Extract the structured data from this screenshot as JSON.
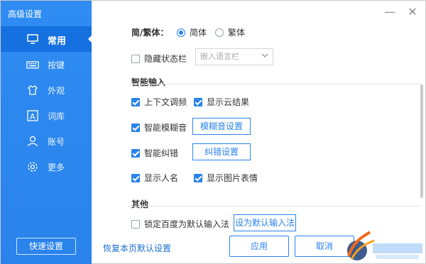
{
  "window": {
    "title": "高级设置",
    "controls": {
      "minimize": "—",
      "close": "✕"
    }
  },
  "sidebar": {
    "items": [
      {
        "label": "常用",
        "icon": "monitor-icon",
        "active": true
      },
      {
        "label": "按键",
        "icon": "keyboard-icon",
        "active": false
      },
      {
        "label": "外观",
        "icon": "shirt-icon",
        "active": false
      },
      {
        "label": "词库",
        "icon": "dictionary-icon",
        "active": false
      },
      {
        "label": "账号",
        "icon": "user-icon",
        "active": false
      },
      {
        "label": "更多",
        "icon": "gear-icon",
        "active": false
      }
    ],
    "quick_settings": "快速设置"
  },
  "settings": {
    "script_label": "简/繁体：",
    "simplified": "简体",
    "traditional": "繁体",
    "script_selected": "简体",
    "hide_statusbar": "隐藏状态栏",
    "hide_statusbar_checked": false,
    "embed_lang_select_placeholder": "嵌入语言栏",
    "smart_input_title": "智能输入",
    "context_adjust": "上下文调频",
    "cloud_results": "显示云结果",
    "fuzzy": "智能模糊音",
    "fuzzy_settings": "模糊音设置",
    "correction": "智能纠错",
    "correction_settings": "纠错设置",
    "show_person_names": "显示人名",
    "show_image_emoji": "显示图片表情",
    "other_title": "其他",
    "lock_default": "锁定百度为默认输入法",
    "set_default": "设为默认输入法"
  },
  "footer": {
    "restore_defaults": "恢复本页默认设置",
    "apply": "应用",
    "cancel": "取消"
  },
  "colors": {
    "accent": "#2a83eb",
    "sidebar": "#2f8cf2",
    "active": "#1570e0"
  }
}
